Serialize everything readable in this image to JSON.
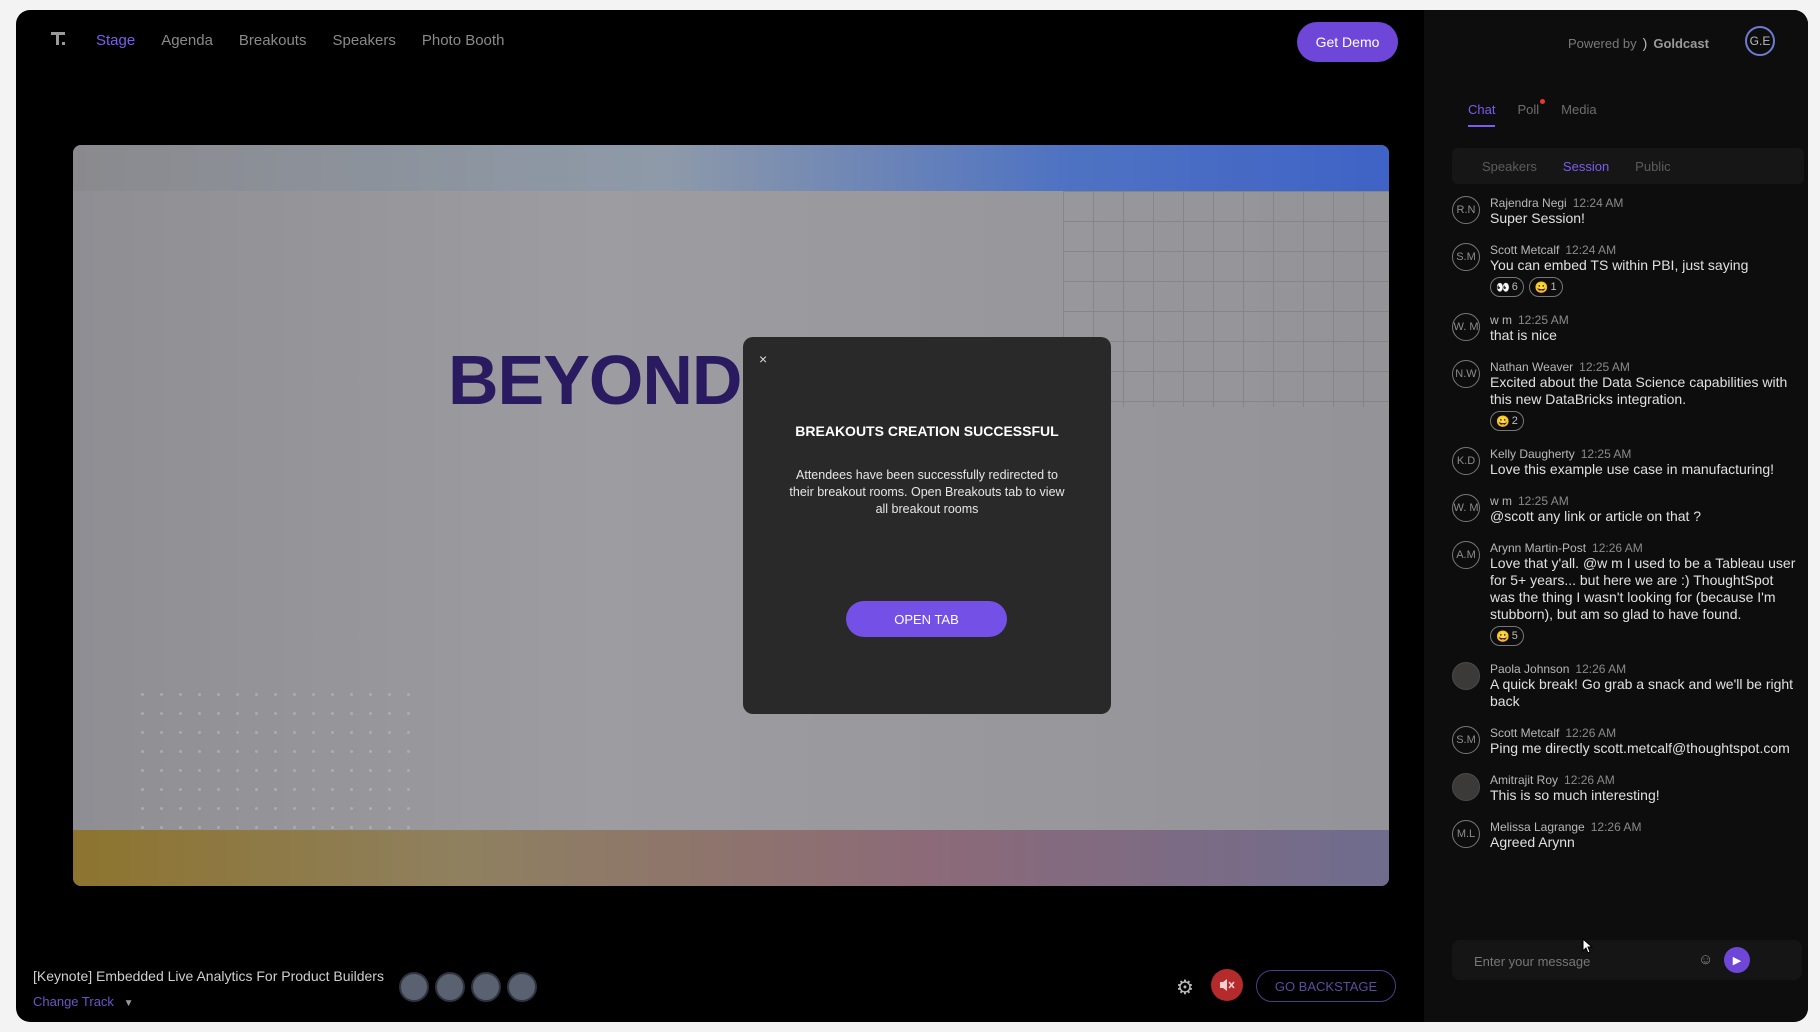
{
  "nav": {
    "items": [
      {
        "label": "Stage"
      },
      {
        "label": "Agenda"
      },
      {
        "label": "Breakouts"
      },
      {
        "label": "Speakers"
      },
      {
        "label": "Photo Booth"
      }
    ],
    "demo_label": "Get Demo"
  },
  "header": {
    "powered_by": "Powered by",
    "brand": "Goldcast",
    "user_initials": "G.E"
  },
  "panel": {
    "tabs": [
      {
        "label": "Chat"
      },
      {
        "label": "Poll"
      },
      {
        "label": "Media"
      }
    ],
    "subtabs": [
      {
        "label": "Speakers"
      },
      {
        "label": "Session"
      },
      {
        "label": "Public"
      }
    ],
    "input_placeholder": "Enter your message"
  },
  "messages": [
    {
      "initials": "R.N",
      "name": "Rajendra Negi",
      "time": "12:24 AM",
      "text": "Super Session!"
    },
    {
      "initials": "S.M",
      "name": "Scott Metcalf",
      "time": "12:24 AM",
      "text": "You can embed TS within PBI, just saying",
      "reactions": [
        {
          "emoji": "👀",
          "count": "6"
        },
        {
          "emoji": "😀",
          "count": "1"
        }
      ]
    },
    {
      "initials": "W. M",
      "name": "w m",
      "time": "12:25 AM",
      "text": "that is nice"
    },
    {
      "initials": "N.W",
      "name": "Nathan Weaver",
      "time": "12:25 AM",
      "text": "Excited about the Data Science capabilities with this new DataBricks integration.",
      "reactions": [
        {
          "emoji": "😀",
          "count": "2"
        }
      ]
    },
    {
      "initials": "K.D",
      "name": "Kelly Daugherty",
      "time": "12:25 AM",
      "text": "Love this example use case in manufacturing!"
    },
    {
      "initials": "W. M",
      "name": "w m",
      "time": "12:25 AM",
      "text": "@scott any link or article on that ?"
    },
    {
      "initials": "A.M",
      "name": "Arynn Martin-Post",
      "time": "12:26 AM",
      "text": "Love that y'all.  @w m I used to be a Tableau user for 5+ years... but here we are :) ThoughtSpot was the thing I wasn't looking for (because I'm stubborn), but am so glad to have found.",
      "reactions": [
        {
          "emoji": "😀",
          "count": "5"
        }
      ]
    },
    {
      "initials": "",
      "name": "Paola Johnson",
      "time": "12:26 AM",
      "text": "A quick break! Go grab a snack and we'll be right back"
    },
    {
      "initials": "S.M",
      "name": "Scott Metcalf",
      "time": "12:26 AM",
      "text": "Ping me directly scott.metcalf@thoughtspot.com"
    },
    {
      "initials": "",
      "name": "Amitrajit Roy",
      "time": "12:26 AM",
      "text": "This is so much interesting!"
    },
    {
      "initials": "M.L",
      "name": "Melissa Lagrange",
      "time": "12:26 AM",
      "text": "Agreed Arynn"
    }
  ],
  "stage": {
    "slide_text": "BEYOND"
  },
  "modal": {
    "close": "×",
    "title": "BREAKOUTS CREATION SUCCESSFUL",
    "body": "Attendees have been successfully redirected to their breakout rooms. Open Breakouts tab to view all breakout rooms",
    "button": "OPEN TAB"
  },
  "footer": {
    "session_title": "[Keynote] Embedded Live Analytics For Product Builders",
    "change_track": "Change Track",
    "backstage": "GO BACKSTAGE"
  }
}
